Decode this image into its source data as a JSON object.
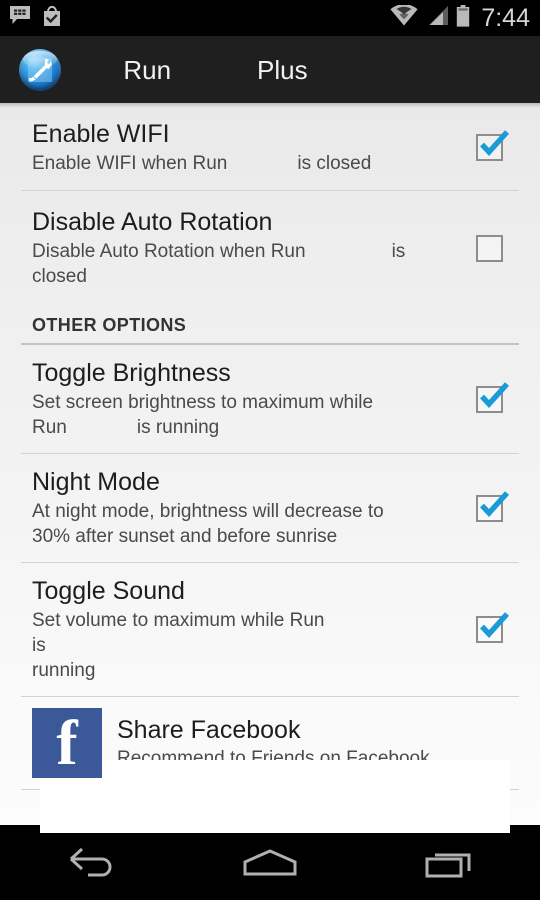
{
  "status_bar": {
    "icons_left": [
      "bbm-message-icon",
      "play-store-update-icon"
    ],
    "icons_right": [
      "wifi-icon",
      "cell-signal-icon",
      "battery-icon"
    ],
    "time": "7:44"
  },
  "action_bar": {
    "app_icon": "wrench-sphere-app-icon",
    "title_part1": "Run",
    "title_part2": "Plus"
  },
  "preferences": [
    {
      "title": "Enable WIFI",
      "summary_a": "Enable WIFI when Run",
      "summary_b": "is closed",
      "checked": true,
      "name": "enable-wifi"
    },
    {
      "title": "Disable Auto Rotation",
      "summary_a": "Disable Auto Rotation when Run",
      "summary_b": "is\nclosed",
      "checked": false,
      "name": "disable-auto-rotation"
    }
  ],
  "section": {
    "header": "OTHER OPTIONS"
  },
  "other_options": [
    {
      "title": "Toggle Brightness",
      "summary_a": "Set screen brightness to maximum while\nRun",
      "summary_b": "is running",
      "checked": true,
      "name": "toggle-brightness"
    },
    {
      "title": "Night Mode",
      "summary_a": "At night mode, brightness will decrease to\n30% after sunset and before sunrise",
      "summary_b": "",
      "checked": true,
      "name": "night-mode"
    },
    {
      "title": "Toggle Sound",
      "summary_a": "Set volume to maximum while Run",
      "summary_b": "is\nrunning",
      "checked": true,
      "name": "toggle-sound"
    }
  ],
  "facebook": {
    "icon": "facebook-icon",
    "icon_glyph": "f",
    "title": "Share Facebook",
    "subtitle": "Recommend to Friends on Facebook",
    "brand_color": "#3b5998"
  },
  "nav_bar": {
    "back": "back-icon",
    "home": "home-icon",
    "recents": "recents-icon"
  },
  "colors": {
    "accent_check": "#1a9ad7",
    "action_bar_bg": "#1f1f1f",
    "status_bar_bg": "#000000",
    "content_bg": "#eeeeee",
    "title_text": "#1d1d1d",
    "summary_text": "#4a4a4a",
    "divider": "#d2d2d2"
  }
}
